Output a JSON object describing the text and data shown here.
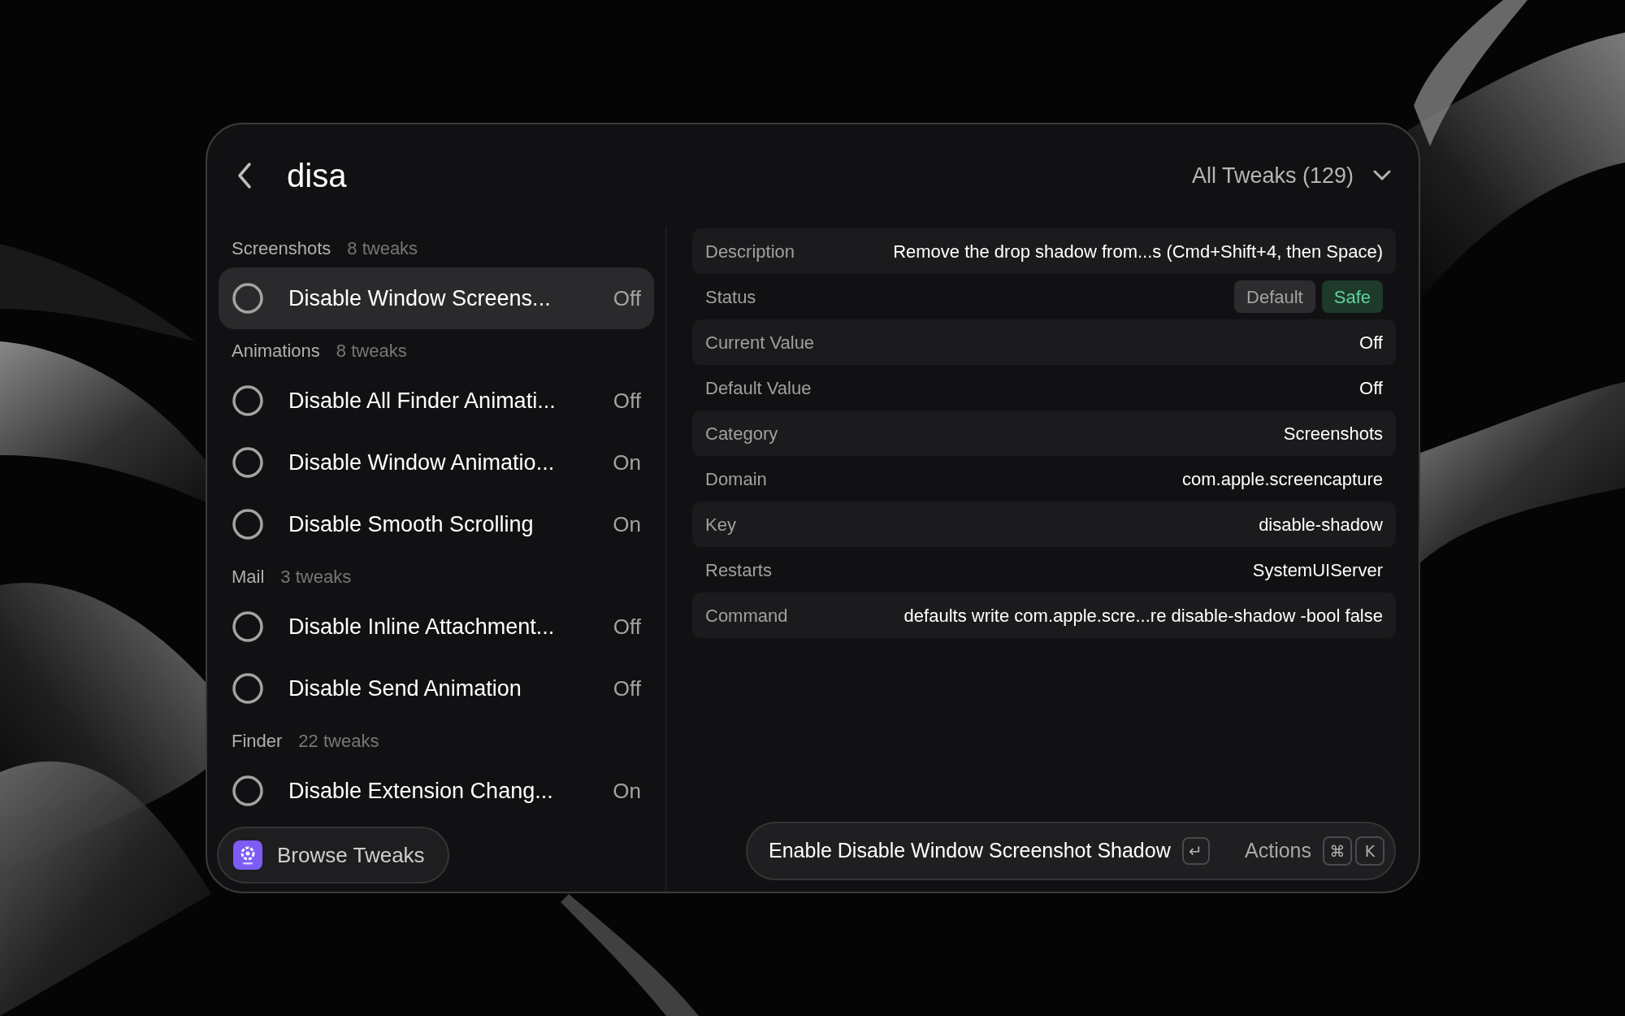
{
  "search": {
    "value": "disa"
  },
  "filter": {
    "label": "All Tweaks (129)"
  },
  "groups": [
    {
      "name": "Screenshots",
      "count": "8 tweaks",
      "items": [
        {
          "title": "Disable Window Screens...",
          "value": "Off",
          "selected": true
        }
      ]
    },
    {
      "name": "Animations",
      "count": "8 tweaks",
      "items": [
        {
          "title": "Disable All Finder Animati...",
          "value": "Off",
          "selected": false
        },
        {
          "title": "Disable Window Animatio...",
          "value": "On",
          "selected": false
        },
        {
          "title": "Disable Smooth Scrolling",
          "value": "On",
          "selected": false
        }
      ]
    },
    {
      "name": "Mail",
      "count": "3 tweaks",
      "items": [
        {
          "title": "Disable Inline Attachment...",
          "value": "Off",
          "selected": false
        },
        {
          "title": "Disable Send Animation",
          "value": "Off",
          "selected": false
        }
      ]
    },
    {
      "name": "Finder",
      "count": "22 tweaks",
      "items": [
        {
          "title": "Disable Extension Chang...",
          "value": "On",
          "selected": false
        }
      ]
    }
  ],
  "browse_button": {
    "label": "Browse Tweaks"
  },
  "details": [
    {
      "kind": "text",
      "label": "Description",
      "value": "Remove the drop shadow from...s (Cmd+Shift+4, then Space)"
    },
    {
      "kind": "badges",
      "label": "Status",
      "badges": [
        {
          "text": "Default",
          "kind": "neutral",
          "color": "#2c2c2e"
        },
        {
          "text": "Safe",
          "kind": "safe",
          "color": "#1d3a2b"
        }
      ]
    },
    {
      "kind": "text",
      "label": "Current Value",
      "value": "Off"
    },
    {
      "kind": "text",
      "label": "Default Value",
      "value": "Off"
    },
    {
      "kind": "text",
      "label": "Category",
      "value": "Screenshots"
    },
    {
      "kind": "text",
      "label": "Domain",
      "value": "com.apple.screencapture"
    },
    {
      "kind": "text",
      "label": "Key",
      "value": "disable-shadow"
    },
    {
      "kind": "text",
      "label": "Restarts",
      "value": "SystemUIServer"
    },
    {
      "kind": "text",
      "label": "Command",
      "value": "defaults write com.apple.scre...re disable-shadow -bool false"
    }
  ],
  "action_bar": {
    "primary": "Enable Disable Window Screenshot Shadow",
    "primary_key": "↵",
    "secondary": "Actions",
    "secondary_keys": [
      "⌘",
      "K"
    ]
  }
}
